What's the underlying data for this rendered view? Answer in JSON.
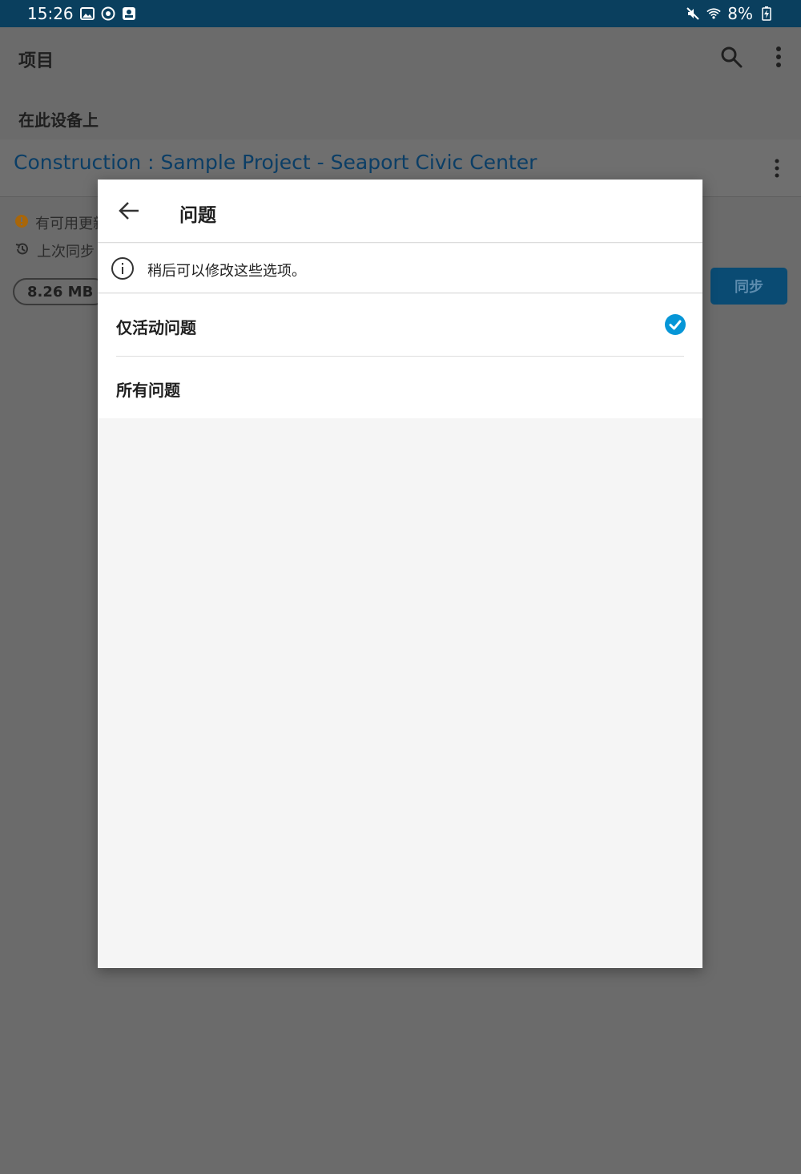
{
  "status_bar": {
    "time": "15:26",
    "battery": "8%",
    "icons": [
      "image-icon",
      "sync-circle-icon",
      "app-badge-icon",
      "mute-icon",
      "wifi-icon",
      "battery-charging-icon"
    ]
  },
  "appbar": {
    "title": "项目",
    "search_icon": "search-icon",
    "more_icon": "more-vert-icon"
  },
  "section": {
    "title": "在此设备上"
  },
  "project": {
    "title": "Construction : Sample Project - Seaport Civic Center",
    "update_text": "有可用更新",
    "last_sync_text": "上次同步",
    "size": "8.26 MB",
    "sync_label": "同步",
    "update_color": "#e08a00",
    "title_color": "#0b3e66"
  },
  "dialog": {
    "title": "问题",
    "info_text": "稍后可以修改这些选项。",
    "options": [
      {
        "label": "仅活动问题",
        "selected": true
      },
      {
        "label": "所有问题",
        "selected": false
      }
    ],
    "accent": "#0696d7"
  }
}
